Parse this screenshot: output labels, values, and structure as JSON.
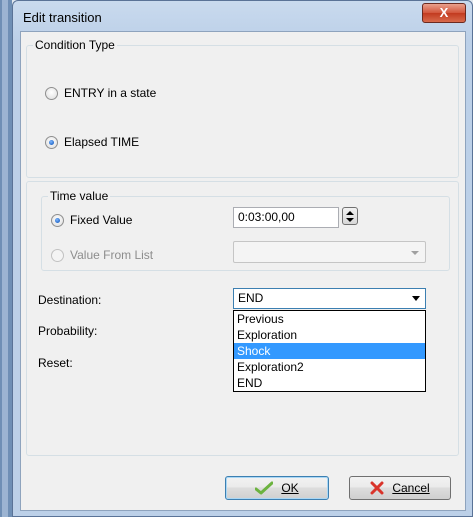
{
  "window": {
    "title": "Edit transition",
    "close_glyph": "X"
  },
  "condition_type": {
    "legend": "Condition Type",
    "options": [
      {
        "label": "ENTRY in a state",
        "checked": false
      },
      {
        "label": "Elapsed TIME",
        "checked": true
      }
    ]
  },
  "time_value": {
    "legend": "Time value",
    "fixed_label": "Fixed Value",
    "fixed_value": "0:03:00,00",
    "list_label": "Value From List",
    "list_value": ""
  },
  "destination": {
    "label": "Destination:",
    "selected": "END",
    "options": [
      "Previous",
      "Exploration",
      "Shock",
      "Exploration2",
      "END"
    ],
    "highlighted": "Shock"
  },
  "probability": {
    "label": "Probability:"
  },
  "reset": {
    "label": "Reset:"
  },
  "buttons": {
    "ok_label": "OK",
    "ok_mnemonic": "O",
    "cancel_label": "Cancel",
    "cancel_mnemonic": "C"
  },
  "colors": {
    "accent": "#3399ff",
    "ok_check": "#6cb33f",
    "cancel_x": "#d9342b"
  },
  "icons": {
    "ok": "check-icon",
    "cancel": "x-icon",
    "close": "close-icon",
    "spinner": "spinner-icon",
    "dropdown": "chevron-down-icon"
  }
}
